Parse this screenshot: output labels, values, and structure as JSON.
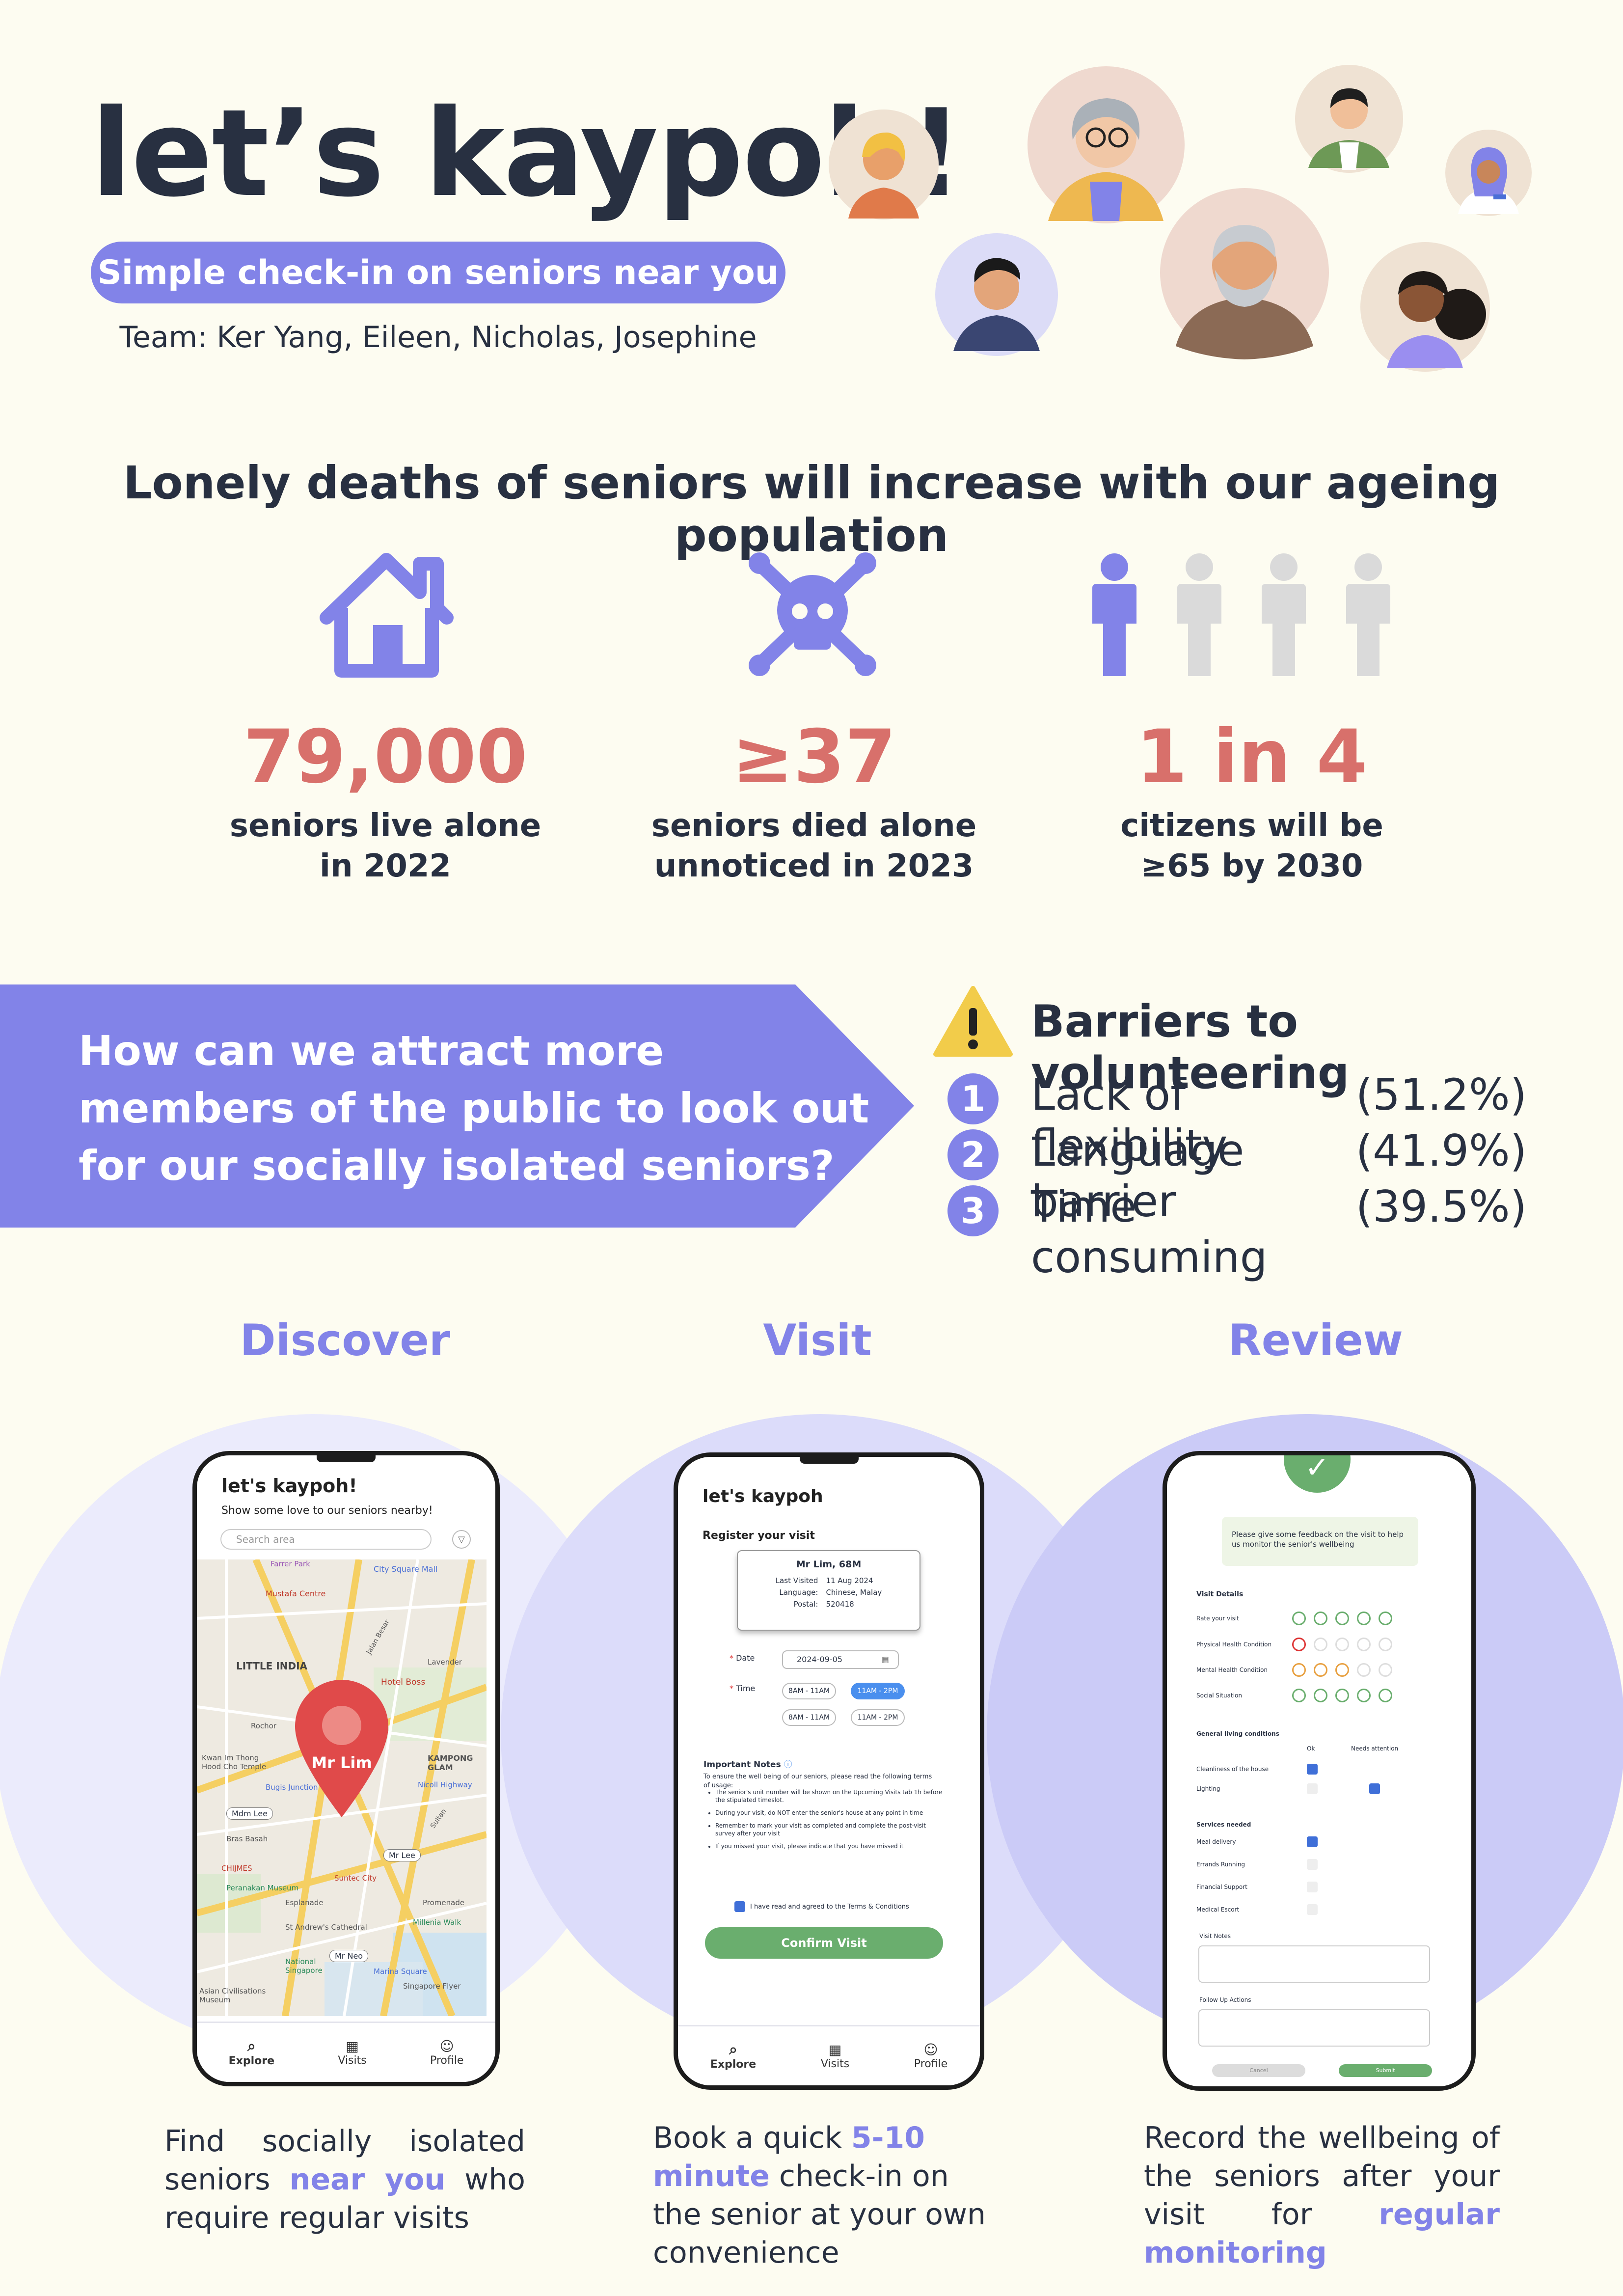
{
  "header": {
    "title": "let’s kaypoh!",
    "tagline": "Simple check-in on seniors near you",
    "team": "Team: Ker Yang, Eileen, Nicholas, Josephine"
  },
  "headline": "Lonely deaths of seniors will increase with our ageing population",
  "stats": [
    {
      "number": "79,000",
      "line1": "seniors live alone",
      "line2": "in 2022"
    },
    {
      "number": "≥37",
      "line1": "seniors died alone",
      "line2": "unnoticed in 2023"
    },
    {
      "number": "1 in 4",
      "line1": "citizens will be",
      "line2": "≥65  by 2030"
    }
  ],
  "question": {
    "line1": "How can we attract more",
    "line2": "members of the public to look out",
    "line3": "for our socially isolated seniors?"
  },
  "barriers": {
    "title": "Barriers to volunteering",
    "items": [
      {
        "n": "1",
        "label": "Lack of flexibility",
        "pct": "(51.2%)"
      },
      {
        "n": "2",
        "label": "Language barrier",
        "pct": "(41.9%)"
      },
      {
        "n": "3",
        "label": "Time consuming",
        "pct": "(39.5%)"
      }
    ]
  },
  "steps": {
    "discover": "Discover",
    "visit": "Visit",
    "review": "Review"
  },
  "phone1": {
    "app_title": "let's kaypoh!",
    "subtitle": "Show some love to our seniors nearby!",
    "search_placeholder": "Search area",
    "pin_label": "Mr Lim",
    "map_labels": [
      "City Square Mall",
      "Mustafa Centre",
      "LITTLE INDIA",
      "Hotel Boss",
      "Kwan Im Thong Hood Cho Temple",
      "Bugis Junction",
      "Bras Basah",
      "CHIJMES",
      "Peranakan Museum",
      "Esplanade",
      "St Andrew's Cathedral",
      "Millenia Walk",
      "Marina Square",
      "Singapore Flyer",
      "Asian Civilisations Museum",
      "National Singapore",
      "KAMPONG GLAM",
      "Nicoll Highway",
      "Lavender",
      "Rochor",
      "Mdm Lee",
      "Mr Lee",
      "Mr Neo",
      "Farrer Park",
      "Jalan Besar",
      "Sultan",
      "Suntec City",
      "Promenade"
    ],
    "tabs": [
      "Explore",
      "Visits",
      "Profile"
    ]
  },
  "phone2": {
    "app_title": "let's kaypoh",
    "section": "Register your visit",
    "senior_name": "Mr Lim, 68M",
    "last_visited_label": "Last Visited",
    "last_visited": "11 Aug 2024",
    "language_label": "Language:",
    "language": "Chinese, Malay",
    "postal_label": "Postal:",
    "postal": "520418",
    "date_label": "Date",
    "date_value": "2024-09-05",
    "time_label": "Time",
    "slots": [
      "8AM - 11AM",
      "11AM - 2PM",
      "8AM - 11AM",
      "11AM - 2PM"
    ],
    "notes_title": "Important Notes",
    "notes_intro": "To ensure the well being of our seniors, please read the following terms of usage:",
    "notes": [
      "The senior's unit number will be shown on the Upcoming Visits tab 1h before the stipulated timeslot.",
      "During your visit, do NOT enter the senior's house at any point in time",
      "Remember to mark your visit as completed and complete the post-visit survey after your visit",
      "If you missed your visit, please indicate that you have missed it"
    ],
    "agree": "I have read and agreed to the Terms & Conditions",
    "confirm": "Confirm Visit",
    "tabs": [
      "Explore",
      "Visits",
      "Profile"
    ]
  },
  "phone3": {
    "banner": "Please give some feedback on the visit to help us monitor the senior's wellbeing",
    "visit_details": "Visit Details",
    "rows": [
      "Rate your visit",
      "Physical Health Condition",
      "Mental Health Condition",
      "Social Situation"
    ],
    "living_title": "General living conditions",
    "ok": "Ok",
    "needs": "Needs attention",
    "living": [
      "Cleanliness of the house",
      "Lighting"
    ],
    "services_title": "Services needed",
    "services": [
      "Meal delivery",
      "Errands Running",
      "Financial Support",
      "Medical Escort"
    ],
    "visit_notes": "Visit Notes",
    "follow_up": "Follow Up Actions",
    "cancel": "Cancel",
    "submit": "Submit"
  },
  "descriptions": {
    "discover": {
      "pre": "Find socially isolated seniors ",
      "hl": "near you",
      "post": " who require regular visits"
    },
    "visit": {
      "pre": "Book a quick ",
      "hl": "5-10 minute",
      "post": " check-in on the senior at your own convenience"
    },
    "review": {
      "pre": "Record the wellbeing of the seniors after your visit for ",
      "hl": "regular monitoring",
      "post": ""
    }
  },
  "colors": {
    "accent": "#8283e8",
    "stat": "#d8706b",
    "text": "#283041",
    "green": "#6aae6e",
    "warning": "#f2cc4a"
  }
}
